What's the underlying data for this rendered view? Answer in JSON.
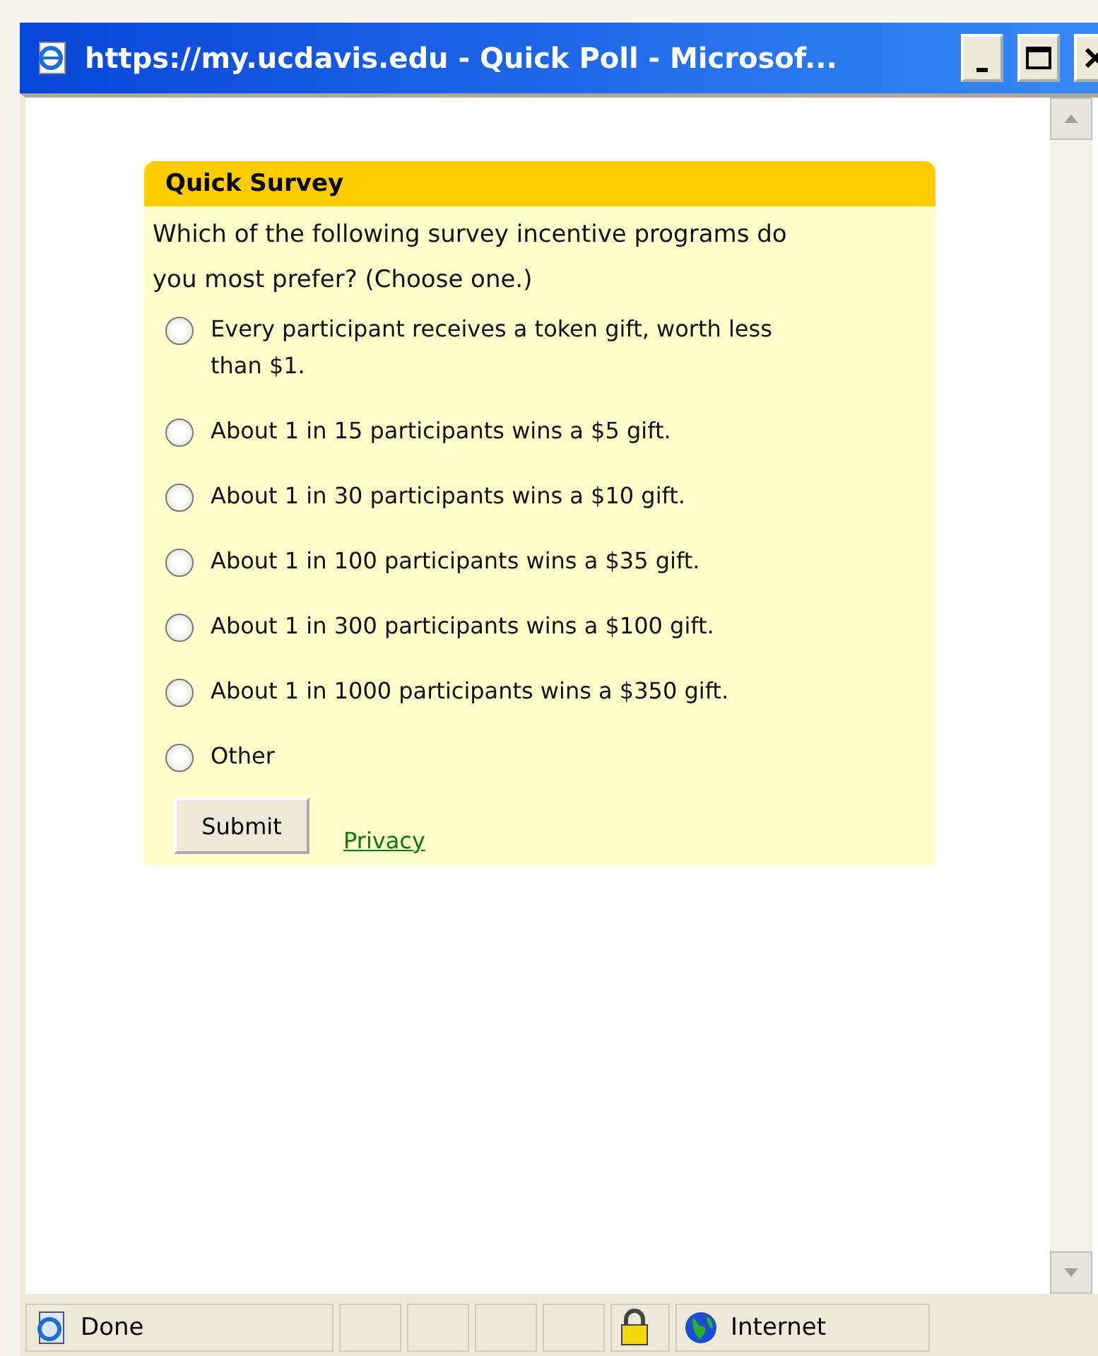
{
  "window": {
    "title": "https://my.ucdavis.edu - Quick Poll - Microsof..."
  },
  "survey": {
    "title": "Quick Survey",
    "question": "Which of the following survey incentive programs do you most prefer? (Choose one.)",
    "options": [
      {
        "label": "Every participant receives a token gift, worth less than $1.",
        "selected": false
      },
      {
        "label": "About 1 in 15 participants wins a $5 gift.",
        "selected": false
      },
      {
        "label": "About 1 in 30 participants wins a $10 gift.",
        "selected": false
      },
      {
        "label": "About 1 in 100 participants wins a $35 gift.",
        "selected": false
      },
      {
        "label": "About 1 in 300 participants wins a $100 gift.",
        "selected": false
      },
      {
        "label": "About 1 in 1000 participants wins a $350 gift.",
        "selected": false
      },
      {
        "label": "Other",
        "selected": false
      }
    ],
    "submit": "Submit",
    "privacy": "Privacy"
  },
  "status_bar": {
    "status": "Done",
    "zone": "Internet"
  }
}
